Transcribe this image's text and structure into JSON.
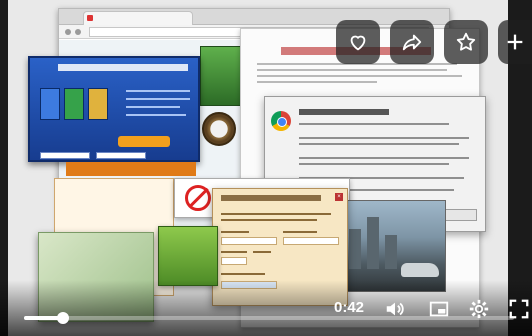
{
  "player": {
    "time": "0:42",
    "progress_fraction": 0.08,
    "actions": [
      {
        "name": "like",
        "icon": "heart-icon"
      },
      {
        "name": "share",
        "icon": "share-icon"
      },
      {
        "name": "save",
        "icon": "star-icon"
      },
      {
        "name": "add",
        "icon": "plus-icon"
      }
    ],
    "controls": {
      "volume_icon": "volume-icon",
      "miniplayer_icon": "miniplayer-icon",
      "settings_icon": "gear-icon",
      "fullscreen_icon": "fullscreen-icon"
    },
    "colors": {
      "progress": "#ffffff",
      "accent": "#e07b18"
    }
  }
}
